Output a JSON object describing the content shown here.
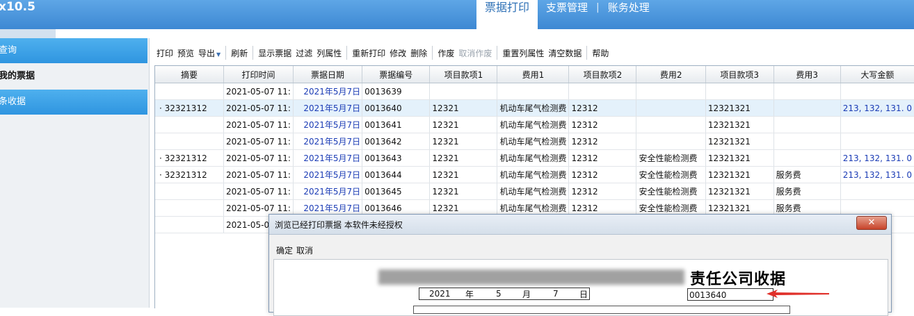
{
  "header": {
    "app_title": "x10.5",
    "tabs": [
      {
        "label": "票据打印",
        "active": true
      },
      {
        "label": "支票管理",
        "active": false
      },
      {
        "label": "账务处理",
        "active": false
      }
    ],
    "tab_separator": "|"
  },
  "sidebar": {
    "items": [
      {
        "label": "查询",
        "style": "blue"
      },
      {
        "label": "我的票据",
        "style": "bold"
      },
      {
        "label": "条收据",
        "style": "blue"
      }
    ]
  },
  "toolbar": {
    "groups": [
      [
        {
          "label": "打印"
        },
        {
          "label": "预览"
        },
        {
          "label": "导出",
          "dropdown": true
        }
      ],
      [
        {
          "label": "刷新"
        }
      ],
      [
        {
          "label": "显示票据"
        },
        {
          "label": "过滤"
        },
        {
          "label": "列属性"
        }
      ],
      [
        {
          "label": "重新打印"
        },
        {
          "label": "修改"
        },
        {
          "label": "删除"
        }
      ],
      [
        {
          "label": "作废"
        },
        {
          "label": "取消作废",
          "disabled": true
        }
      ],
      [
        {
          "label": "重置列属性"
        },
        {
          "label": "清空数据"
        }
      ],
      [
        {
          "label": "帮助"
        }
      ]
    ]
  },
  "grid": {
    "columns": [
      "摘要",
      "打印时间",
      "票据日期",
      "票据编号",
      "项目款项1",
      "费用1",
      "项目款项2",
      "费用2",
      "项目款项3",
      "费用3",
      "大写金额"
    ],
    "rows": [
      [
        "",
        "2021-05-07 11:",
        "2021年5月7日",
        "0013639",
        "",
        "",
        "",
        "",
        "",
        "",
        ""
      ],
      [
        "· 32321312",
        "2021-05-07 11:",
        "2021年5月7日",
        "0013640",
        "12321",
        "机动车尾气检测费",
        "12312",
        "",
        "12321321",
        "",
        "213, 132, 131. 0"
      ],
      [
        "",
        "2021-05-07 11:",
        "2021年5月7日",
        "0013641",
        "12321",
        "机动车尾气检测费",
        "12312",
        "",
        "12321321",
        "",
        ""
      ],
      [
        "",
        "2021-05-07 11:",
        "2021年5月7日",
        "0013642",
        "12321",
        "机动车尾气检测费",
        "12312",
        "",
        "12321321",
        "",
        ""
      ],
      [
        "· 32321312",
        "2021-05-07 11:",
        "2021年5月7日",
        "0013643",
        "12321",
        "机动车尾气检测费",
        "12312",
        "安全性能检测费",
        "12321321",
        "",
        "213, 132, 131. 0"
      ],
      [
        "· 32321312",
        "2021-05-07 11:",
        "2021年5月7日",
        "0013644",
        "12321",
        "机动车尾气检测费",
        "12312",
        "安全性能检测费",
        "12321321",
        "服务费",
        "213, 132, 131. 0"
      ],
      [
        "",
        "2021-05-07 11:",
        "2021年5月7日",
        "0013645",
        "12321",
        "机动车尾气检测费",
        "12312",
        "安全性能检测费",
        "12321321",
        "服务费",
        ""
      ],
      [
        "",
        "2021-05-07 11:",
        "2021年5月7日",
        "0013646",
        "12321",
        "机动车尾气检测费",
        "12312",
        "安全性能检测费",
        "12321321",
        "服务费",
        ""
      ],
      [
        "",
        "2021-05-0",
        "",
        "",
        "",
        "",
        "",
        "",
        "",
        "",
        ""
      ]
    ],
    "selected_row": 1
  },
  "dialog": {
    "title": "浏览已经打印票据 本软件未经授权",
    "close_symbol": "✕",
    "menu": [
      "确定",
      "取消"
    ],
    "receipt_title": "责任公司收据",
    "date": {
      "year": "2021",
      "year_unit": "年",
      "month": "5",
      "month_unit": "月",
      "day": "7",
      "day_unit": "日"
    },
    "receipt_no": "0013640",
    "arrow_color": "#e0302a"
  }
}
